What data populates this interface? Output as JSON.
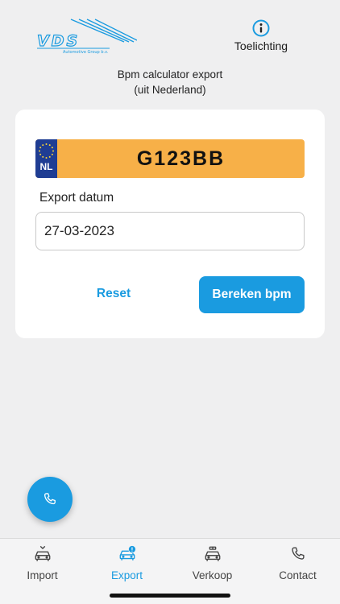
{
  "header": {
    "logo_text": "VDS",
    "logo_subtext": "Automotive Group b.v.",
    "info_label": "Toelichting"
  },
  "subtitle": {
    "line1": "Bpm calculator export",
    "line2": "(uit Nederland)"
  },
  "plate": {
    "country_code": "NL",
    "number": "G123BB"
  },
  "form": {
    "date_label": "Export datum",
    "date_value": "27-03-2023",
    "reset_label": "Reset",
    "calculate_label": "Bereken bpm"
  },
  "tabs": [
    {
      "label": "Import",
      "icon": "car-icon",
      "active": false
    },
    {
      "label": "Export",
      "icon": "car-export-icon",
      "active": true
    },
    {
      "label": "Verkoop",
      "icon": "car-sale-icon",
      "active": false
    },
    {
      "label": "Contact",
      "icon": "phone-icon",
      "active": false
    }
  ],
  "colors": {
    "accent": "#1a9be0",
    "plate_yellow": "#f7b048",
    "plate_blue": "#1f3d93",
    "background": "#efeff0"
  }
}
